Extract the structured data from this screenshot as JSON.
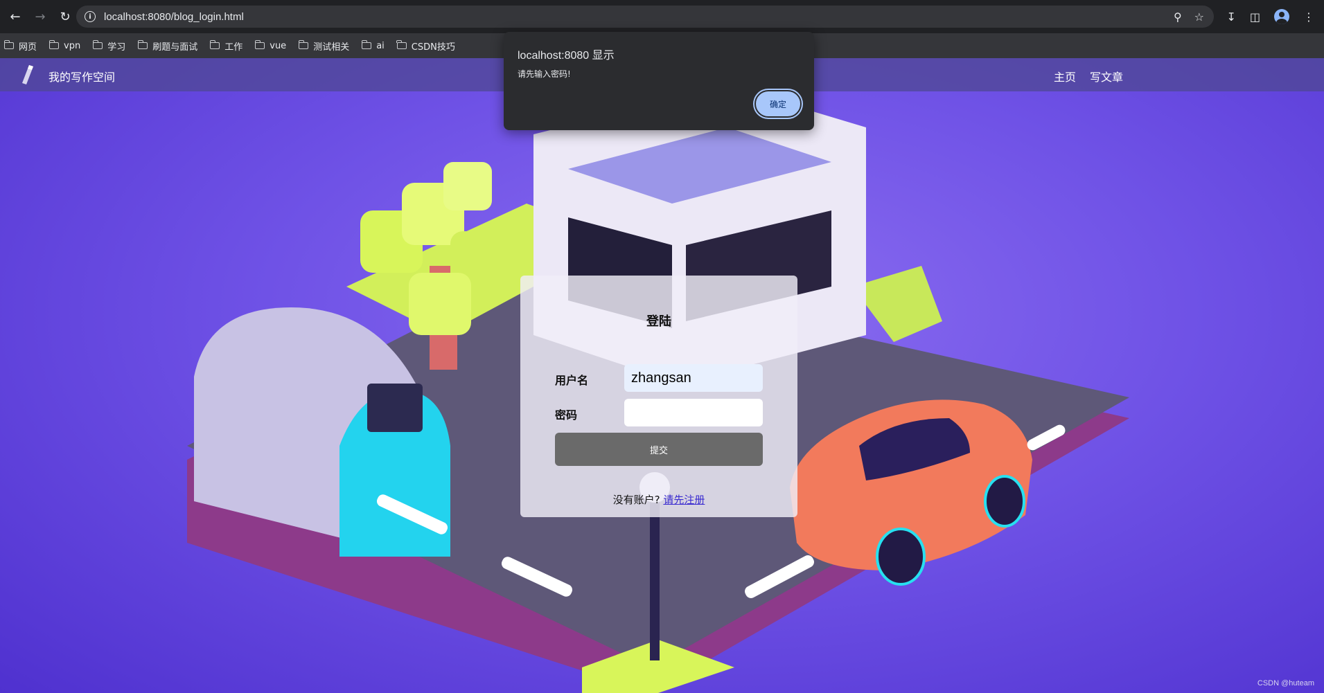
{
  "browser": {
    "url": "localhost:8080/blog_login.html",
    "bookmarks": [
      "网页",
      "vpn",
      "学习",
      "刷题与面试",
      "工作",
      "vue",
      "测试相关",
      "ai",
      "CSDN技巧"
    ]
  },
  "site": {
    "title": "我的写作空间",
    "nav": [
      "主页",
      "写文章"
    ]
  },
  "login": {
    "title": "登陆",
    "username_label": "用户名",
    "username_value": "zhangsan",
    "password_label": "密码",
    "password_value": "",
    "submit_label": "提交",
    "no_account_text": "没有账户?",
    "register_link": "请先注册"
  },
  "dialog": {
    "title": "localhost:8080 显示",
    "message": "请先输入密码!",
    "ok_label": "确定"
  },
  "watermark": "CSDN @huteam",
  "colors": {
    "page_background": "#6a4fe0",
    "nav_bar": "#504896",
    "submit_button": "#6a6a6a",
    "dialog_background": "#2b2c2f",
    "dialog_button": "#a8c7fa"
  }
}
